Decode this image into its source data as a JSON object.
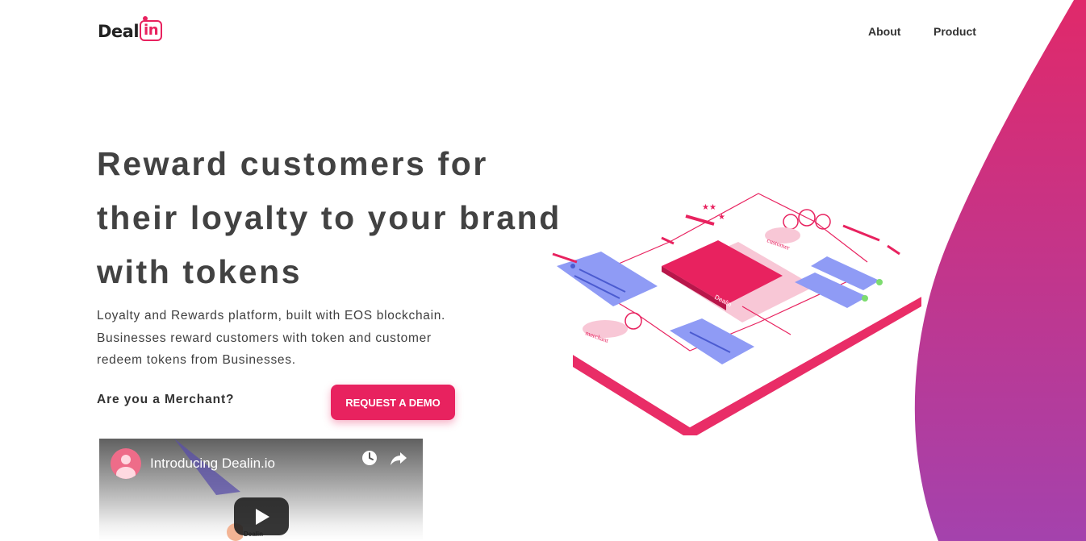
{
  "header": {
    "logo_text": "Deal",
    "logo_badge": "in",
    "nav": {
      "about": "About",
      "product": "Product"
    }
  },
  "hero": {
    "title": "Reward customers for their loyalty to your brand with tokens",
    "description": "Loyalty and Rewards platform, built with EOS blockchain. Businesses reward customers with token and customer redeem tokens from Businesses.",
    "merchant_question": "Are you a Merchant?",
    "cta_label": "REQUEST A DEMO"
  },
  "video": {
    "title": "Introducing Dealin.io",
    "thumb_label": "Dealin"
  },
  "illustration": {
    "labels": {
      "customer": "customer",
      "merchant": "merchant",
      "brand": "Dealin"
    }
  },
  "colors": {
    "brand_pink": "#e8225f",
    "gradient_top": "#d52a6a",
    "gradient_bottom": "#a442ad",
    "card_blue": "#8f9bf5"
  },
  "icons": [
    "clock-icon",
    "share-icon",
    "play-icon",
    "avatar-icon"
  ]
}
